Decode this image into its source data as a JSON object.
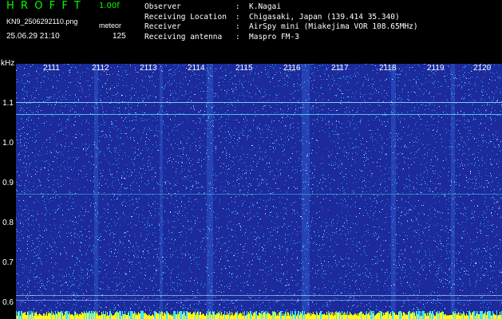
{
  "header": {
    "app_title": "HROFFT",
    "version": "1.00f",
    "filename": "KN9_2506292110.png",
    "mode": "meteor",
    "datetime": "25.06.29 21:10",
    "count": "125"
  },
  "info": [
    {
      "label": "Observer",
      "value": "K.Nagai"
    },
    {
      "label": "Receiving Location",
      "value": "Chigasaki, Japan (139.414 35.340)"
    },
    {
      "label": "Receiver",
      "value": "AirSpy mini (Miakejima VOR 108.65MHz)"
    },
    {
      "label": "Receiving antenna",
      "value": "Maspro FM-3"
    }
  ],
  "axes": {
    "y_unit": "kHz",
    "y_ticks": [
      "1.1",
      "1.0",
      "0.9",
      "0.8",
      "0.7",
      "0.6"
    ],
    "x_ticks": [
      "2111",
      "2112",
      "2113",
      "2114",
      "2115",
      "2116",
      "2117",
      "2118",
      "2119",
      "2120"
    ]
  },
  "colors": {
    "title_green": "#00ff00",
    "spectrogram_bg": "#1c2a9c",
    "noise_cyan": "#2fd0ff",
    "signal_yellow": "#ffff00"
  }
}
